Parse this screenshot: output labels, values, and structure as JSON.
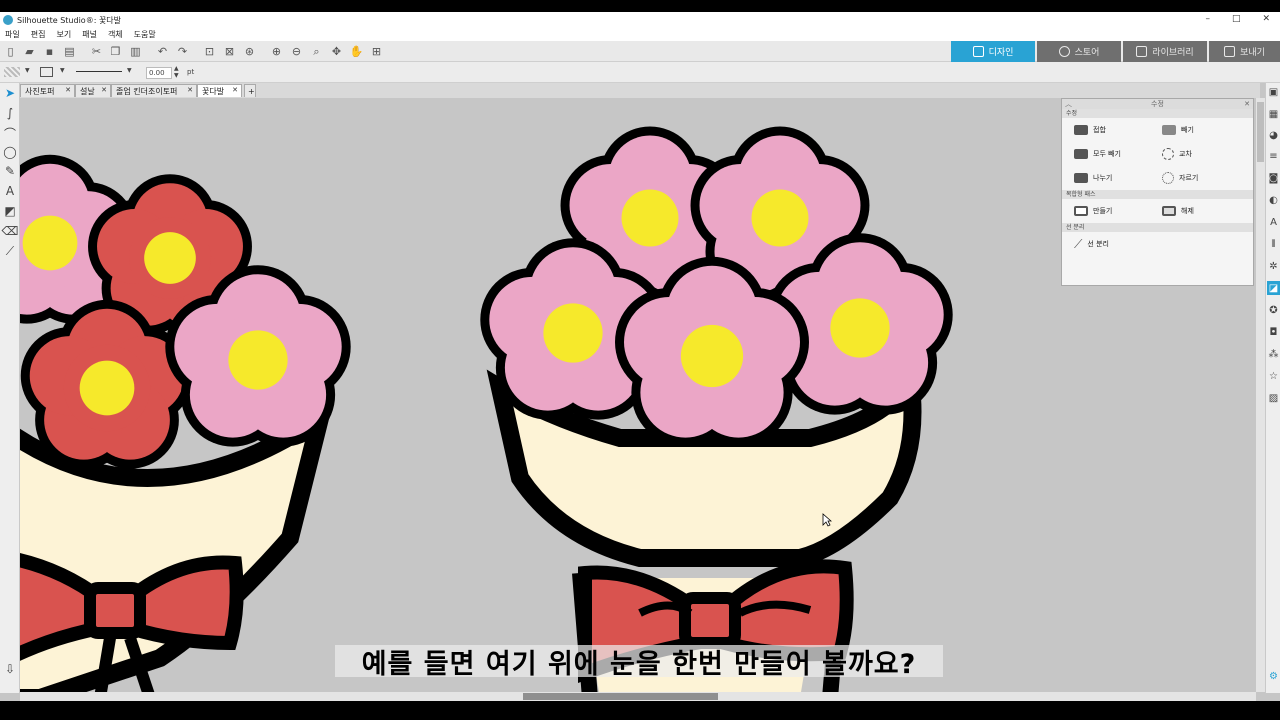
{
  "app": {
    "title": "Silhouette Studio®: 꽃다발",
    "window_controls": [
      "–",
      "□",
      "✕"
    ]
  },
  "menu": [
    "파일",
    "편집",
    "보기",
    "패널",
    "객체",
    "도움말"
  ],
  "nav_tabs": [
    {
      "label": "디자인",
      "icon": "grid-icon",
      "active": true
    },
    {
      "label": "스토어",
      "icon": "silhouette-logo-icon",
      "active": false
    },
    {
      "label": "라이브러리",
      "icon": "library-icon",
      "active": false
    },
    {
      "label": "보내기",
      "icon": "cutter-icon",
      "active": false
    }
  ],
  "options": {
    "line_width": "0.00",
    "unit": "pt"
  },
  "doc_tabs": [
    {
      "label": "사진토퍼",
      "active": false
    },
    {
      "label": "설날",
      "active": false
    },
    {
      "label": "졸업 킨더조이토퍼",
      "active": false
    },
    {
      "label": "꽃다발",
      "active": true
    }
  ],
  "modify_panel": {
    "title": "수정",
    "sections": [
      {
        "header": "수정",
        "items": [
          "접합",
          "빼기",
          "모두 빼기",
          "교차",
          "나누기",
          "자르기"
        ]
      },
      {
        "header": "복합형 패스",
        "items": [
          "만들기",
          "해제"
        ]
      },
      {
        "header": "선 분리",
        "items": [
          "선 분리"
        ]
      }
    ]
  },
  "subtitle": "예를 들면 여기 위에 눈을 한번 만들어 볼까요?",
  "colors": {
    "accent": "#29a3d4",
    "canvas_bg": "#c6c6c6",
    "pink_petal": "#eba6c6",
    "red_petal": "#d9534f",
    "flower_center": "#f6e92b",
    "wrap": "#fdf3d6",
    "outline": "#000000"
  }
}
